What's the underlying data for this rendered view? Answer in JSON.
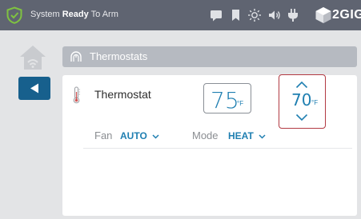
{
  "header": {
    "status_prefix": "System ",
    "status_bold": "Ready",
    "status_suffix": " To Arm",
    "brand": "2GIG",
    "icons": [
      "message-icon",
      "bookmark-icon",
      "brightness-icon",
      "volume-icon",
      "power-plug-icon"
    ]
  },
  "breadcrumb": {
    "title": "Thermostats"
  },
  "device": {
    "name": "Thermostat",
    "current_temp": "75",
    "current_unit": "°F",
    "setpoint": "70",
    "setpoint_unit": "°F",
    "fan_label": "Fan",
    "fan_value": "AUTO",
    "mode_label": "Mode",
    "mode_value": "HEAT"
  },
  "colors": {
    "accent": "#1f7fb1",
    "header": "#5f6471",
    "back_button": "#17608d",
    "highlight": "#b23a43",
    "shield": "#7fc241"
  }
}
